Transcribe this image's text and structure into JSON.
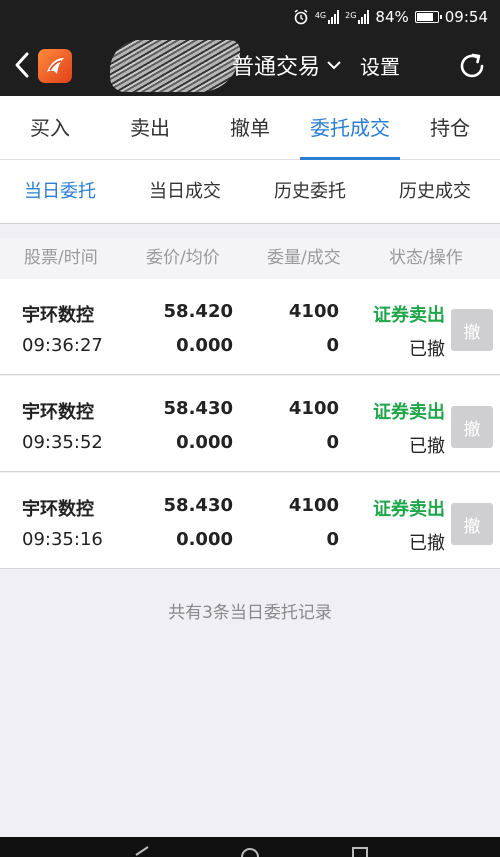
{
  "status_bar": {
    "network_1": "4G",
    "network_2": "2G",
    "battery": "84%",
    "battery_level": 0.84,
    "time": "09:54"
  },
  "nav": {
    "title": "普通交易",
    "settings": "设置"
  },
  "main_tabs": [
    "买入",
    "卖出",
    "撤单",
    "委托成交",
    "持仓"
  ],
  "main_tab_active": 3,
  "sub_tabs": [
    "当日委托",
    "当日成交",
    "历史委托",
    "历史成交"
  ],
  "sub_tab_active": 0,
  "table_header": [
    "股票/时间",
    "委价/均价",
    "委量/成交",
    "状态/操作"
  ],
  "orders": [
    {
      "name": "宇环数控",
      "time": "09:36:27",
      "price": "58.420",
      "avg_price": "0.000",
      "quantity": "4100",
      "filled": "0",
      "action": "证券卖出",
      "status": "已撤",
      "cancel": "撤"
    },
    {
      "name": "宇环数控",
      "time": "09:35:52",
      "price": "58.430",
      "avg_price": "0.000",
      "quantity": "4100",
      "filled": "0",
      "action": "证券卖出",
      "status": "已撤",
      "cancel": "撤"
    },
    {
      "name": "宇环数控",
      "time": "09:35:16",
      "price": "58.430",
      "avg_price": "0.000",
      "quantity": "4100",
      "filled": "0",
      "action": "证券卖出",
      "status": "已撤",
      "cancel": "撤"
    }
  ],
  "footer_note": "共有3条当日委托记录",
  "colors": {
    "accent": "#2a7fd4",
    "sell": "#1fa64a",
    "dark_bar": "#1e1e1e"
  }
}
